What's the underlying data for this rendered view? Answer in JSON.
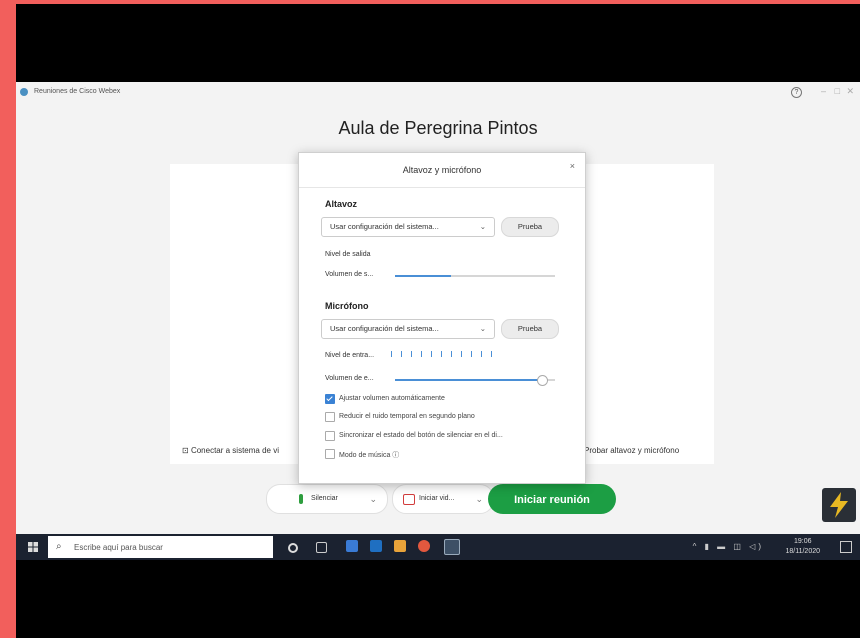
{
  "app": {
    "title": "Reuniones de Cisco Webex",
    "help_label": "?",
    "meeting_title": "Aula de Peregrina Pintos",
    "connect_audio_label": "Conectar a sistema de vi",
    "test_audio_label": "Probar altavoz y micrófono"
  },
  "dialog": {
    "title": "Altavoz y micrófono",
    "close_label": "×",
    "speaker": {
      "heading": "Altavoz",
      "device": "Usar configuración del sistema...",
      "test_label": "Prueba",
      "output_level_label": "Nivel de salida",
      "volume_label": "Volumen de s...",
      "volume_fraction": 0.35
    },
    "microphone": {
      "heading": "Micrófono",
      "device": "Usar configuración del sistema...",
      "test_label": "Prueba",
      "input_level_label": "Nivel de entra...",
      "volume_label": "Volumen de e...",
      "volume_fraction": 0.92
    },
    "options": [
      {
        "label": "Ajustar volumen automáticamente",
        "checked": true
      },
      {
        "label": "Reducir el ruido temporal en segundo plano",
        "checked": false
      },
      {
        "label": "Sincronizar el estado del botón de silenciar en el di...",
        "checked": false
      },
      {
        "label": "Modo de música ⓘ",
        "checked": false
      }
    ]
  },
  "controls": {
    "mute_label": "Silenciar",
    "video_label": "Iniciar vid...",
    "start_label": "Iniciar reunión"
  },
  "taskbar": {
    "search_placeholder": "Escribe aquí para buscar",
    "time": "19:06",
    "date": "18/11/2020"
  },
  "colors": {
    "frame": "#f25f5c",
    "start_button": "#1c9e44",
    "accent": "#3a82d4"
  }
}
